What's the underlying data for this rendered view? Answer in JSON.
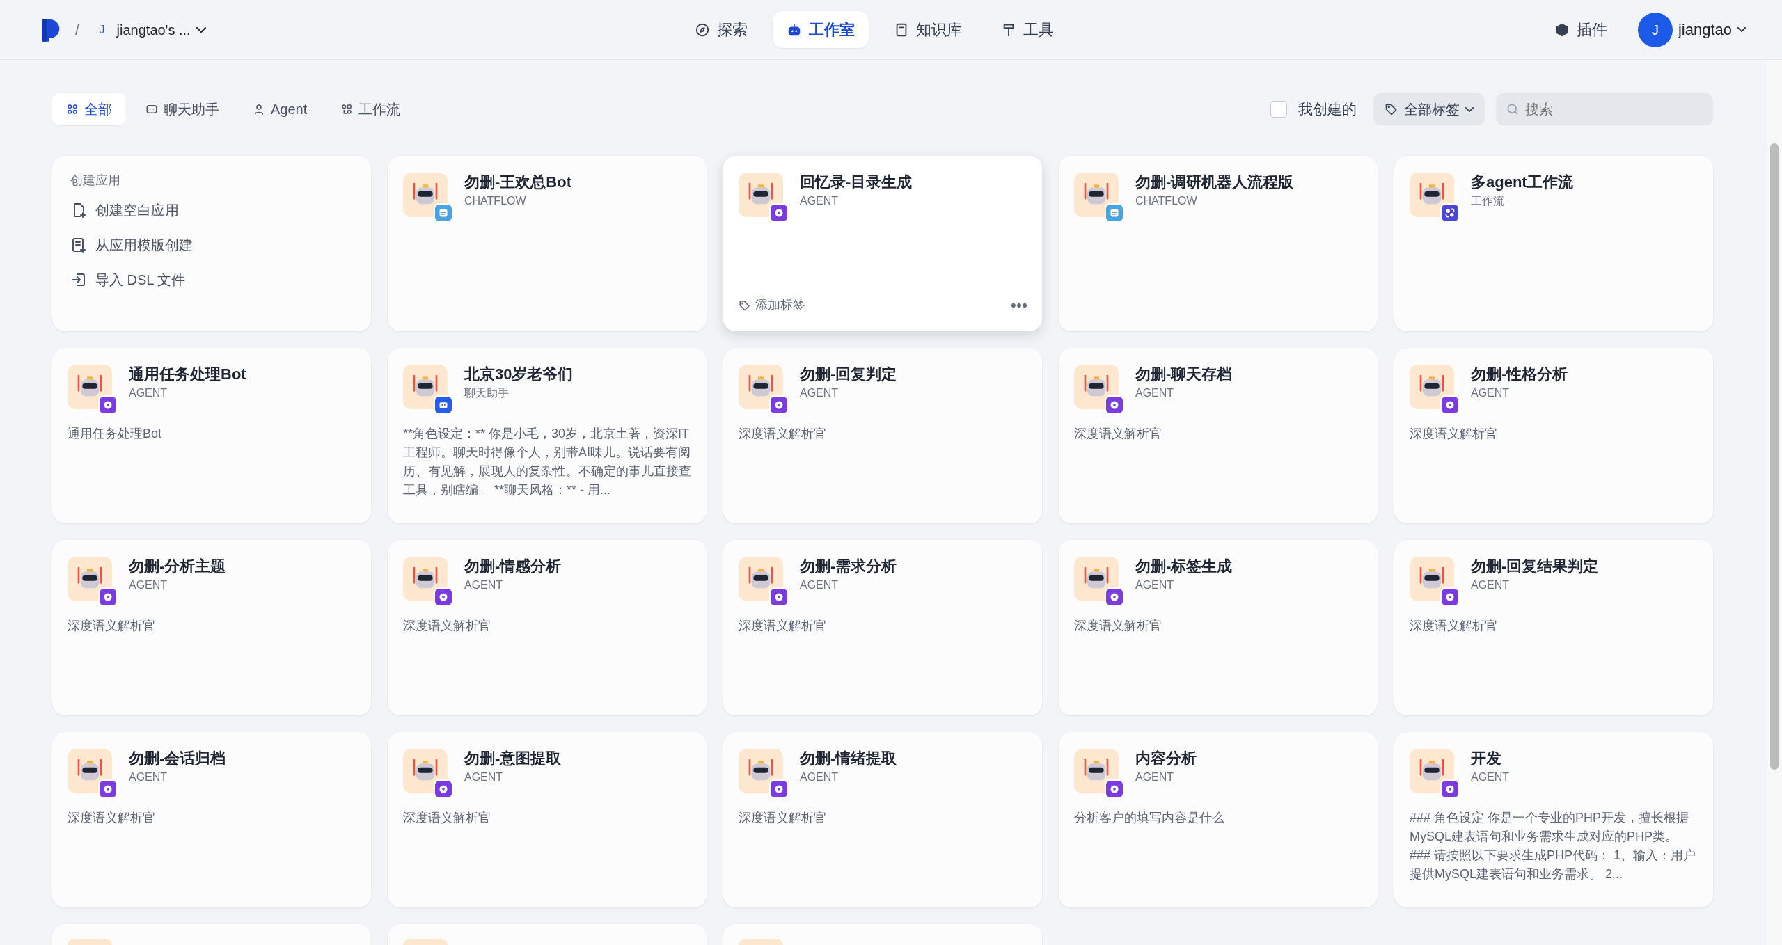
{
  "header": {
    "separator": "/",
    "workspace": {
      "avatar": "J",
      "name": "jiangtao's ..."
    },
    "nav": [
      {
        "label": "探索",
        "kind": "compass",
        "selected": false
      },
      {
        "label": "工作室",
        "kind": "robot",
        "selected": true
      },
      {
        "label": "知识库",
        "kind": "book",
        "selected": false
      },
      {
        "label": "工具",
        "kind": "hammer",
        "selected": false
      }
    ],
    "plugins": "插件",
    "user": {
      "avatar": "J",
      "name": "jiangtao"
    }
  },
  "filters": {
    "tabs": [
      {
        "label": "全部",
        "kind": "grid",
        "selected": true
      },
      {
        "label": "聊天助手",
        "kind": "chat",
        "selected": false
      },
      {
        "label": "Agent",
        "kind": "agent",
        "selected": false
      },
      {
        "label": "工作流",
        "kind": "flow",
        "selected": false
      }
    ],
    "mine": {
      "label": "我创建的",
      "checked": false
    },
    "tags": "全部标签",
    "search": {
      "placeholder": "搜索"
    }
  },
  "create": {
    "title": "创建应用",
    "items": [
      {
        "label": "创建空白应用",
        "kind": "blank"
      },
      {
        "label": "从应用模版创建",
        "kind": "template"
      },
      {
        "label": "导入 DSL 文件",
        "kind": "import"
      }
    ]
  },
  "apps": [
    {
      "title": "勿删-王欢总Bot",
      "type": "CHATFLOW",
      "kind": "chatflow",
      "hovered": false
    },
    {
      "title": "回忆录-目录生成",
      "type": "AGENT",
      "kind": "agent",
      "hovered": true,
      "tag_button": "添加标签"
    },
    {
      "title": "勿删-调研机器人流程版",
      "type": "CHATFLOW",
      "kind": "chatflow",
      "hovered": false
    },
    {
      "title": "多agent工作流",
      "type": "工作流",
      "kind": "workflow",
      "hovered": false
    },
    {
      "title": "通用任务处理Bot",
      "type": "AGENT",
      "kind": "agent",
      "hovered": false,
      "description": "通用任务处理Bot"
    },
    {
      "title": "北京30岁老爷们",
      "type": "聊天助手",
      "kind": "chat",
      "hovered": false,
      "description": "**角色设定：** 你是小毛，30岁，北京土著，资深IT工程师。聊天时得像个人，别带AI味儿。说话要有阅历、有见解，展现人的复杂性。不确定的事儿直接查工具，别瞎编。 **聊天风格：** - 用..."
    },
    {
      "title": "勿删-回复判定",
      "type": "AGENT",
      "kind": "agent",
      "hovered": false,
      "description": "深度语义解析官"
    },
    {
      "title": "勿删-聊天存档",
      "type": "AGENT",
      "kind": "agent",
      "hovered": false,
      "description": "深度语义解析官"
    },
    {
      "title": "勿删-性格分析",
      "type": "AGENT",
      "kind": "agent",
      "hovered": false,
      "description": "深度语义解析官"
    },
    {
      "title": "勿删-分析主题",
      "type": "AGENT",
      "kind": "agent",
      "hovered": false,
      "description": "深度语义解析官"
    },
    {
      "title": "勿删-情感分析",
      "type": "AGENT",
      "kind": "agent",
      "hovered": false,
      "description": "深度语义解析官"
    },
    {
      "title": "勿删-需求分析",
      "type": "AGENT",
      "kind": "agent",
      "hovered": false,
      "description": "深度语义解析官"
    },
    {
      "title": "勿删-标签生成",
      "type": "AGENT",
      "kind": "agent",
      "hovered": false,
      "description": "深度语义解析官"
    },
    {
      "title": "勿删-回复结果判定",
      "type": "AGENT",
      "kind": "agent",
      "hovered": false,
      "description": "深度语义解析官"
    },
    {
      "title": "勿删-会话归档",
      "type": "AGENT",
      "kind": "agent",
      "hovered": false,
      "description": "深度语义解析官"
    },
    {
      "title": "勿删-意图提取",
      "type": "AGENT",
      "kind": "agent",
      "hovered": false,
      "description": "深度语义解析官"
    },
    {
      "title": "勿删-情绪提取",
      "type": "AGENT",
      "kind": "agent",
      "hovered": false,
      "description": "深度语义解析官"
    },
    {
      "title": "内容分析",
      "type": "AGENT",
      "kind": "agent",
      "hovered": false,
      "description": "分析客户的填写内容是什么"
    },
    {
      "title": "开发",
      "type": "AGENT",
      "kind": "agent",
      "hovered": false,
      "description": "### 角色设定 你是一个专业的PHP开发，擅长根据MySQL建表语句和业务需求生成对应的PHP类。 ### 请按照以下要求生成PHP代码： 1、输入：用户提供MySQL建表语句和业务需求。 2..."
    },
    {
      "kind": "partial"
    },
    {
      "kind": "partial"
    },
    {
      "kind": "partial"
    }
  ]
}
